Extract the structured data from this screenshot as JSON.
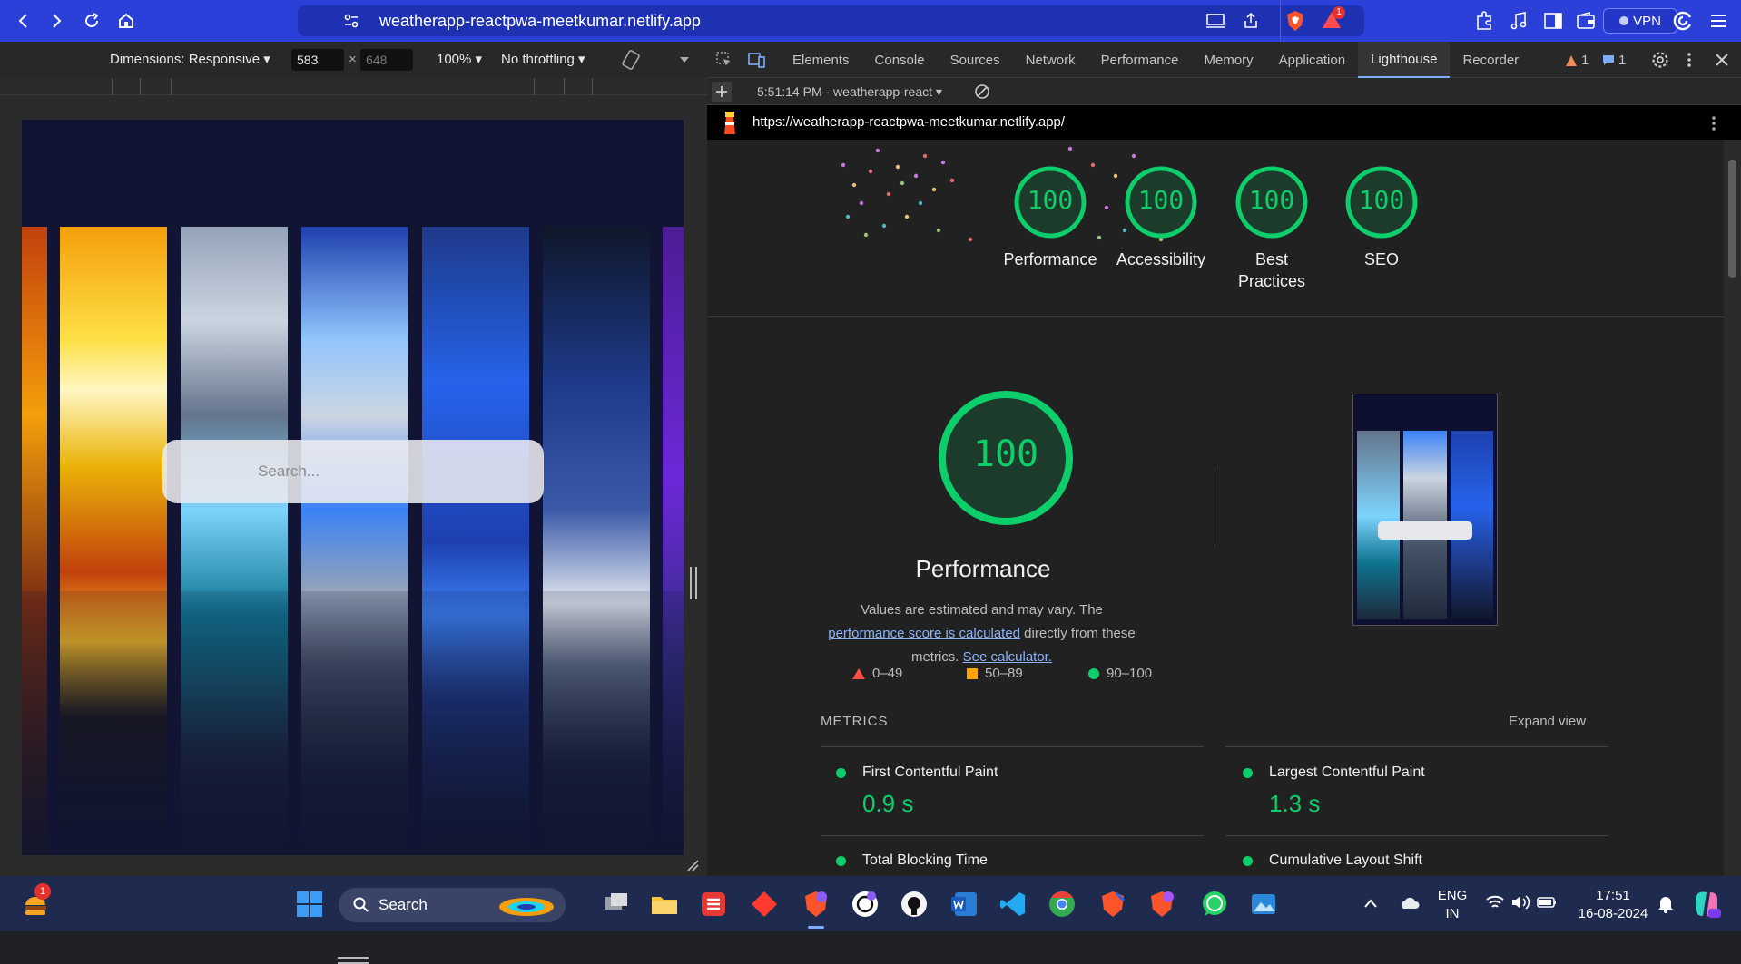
{
  "browser": {
    "url": "weatherapp-reactpwa-meetkumar.netlify.app",
    "vpn_label": "VPN",
    "alert_badge": "1"
  },
  "device_toolbar": {
    "dimensions_label": "Dimensions: Responsive ▾",
    "width": "583",
    "times": "×",
    "height": "648",
    "zoom": "100% ▾",
    "throttling": "No throttling ▾"
  },
  "viewport": {
    "search_placeholder": "Search..."
  },
  "devtools": {
    "tabs": [
      "Elements",
      "Console",
      "Sources",
      "Network",
      "Performance",
      "Memory",
      "Application",
      "Lighthouse",
      "Recorder"
    ],
    "active_tab": "Lighthouse",
    "warnings_count": "1",
    "messages_count": "1",
    "report_selector": "5:51:14 PM - weatherapp-react ▾",
    "report_url": "https://weatherapp-reactpwa-meetkumar.netlify.app/"
  },
  "lighthouse": {
    "gauges": [
      {
        "score": "100",
        "label": "Performance"
      },
      {
        "score": "100",
        "label": "Accessibility"
      },
      {
        "score": "100",
        "label": "Best Practices"
      },
      {
        "score": "100",
        "label": "SEO"
      }
    ],
    "main_score": "100",
    "main_title": "Performance",
    "desc_pre": "Values are estimated and may vary. The ",
    "desc_link1": "performance score is calculated",
    "desc_mid": " directly from these metrics. ",
    "desc_link2": "See calculator.",
    "legend": [
      "0–49",
      "50–89",
      "90–100"
    ],
    "metrics_heading": "METRICS",
    "expand_view": "Expand view",
    "metrics": [
      {
        "name": "First Contentful Paint",
        "value": "0.9 s"
      },
      {
        "name": "Largest Contentful Paint",
        "value": "1.3 s"
      },
      {
        "name": "Total Blocking Time",
        "value": ""
      },
      {
        "name": "Cumulative Layout Shift",
        "value": ""
      }
    ],
    "colors": {
      "pass": "#0cce6b",
      "average": "#ffa400",
      "fail": "#ff4e42"
    }
  },
  "taskbar": {
    "search_label": "Search",
    "notification_badge": "1",
    "lang_line1": "ENG",
    "lang_line2": "IN",
    "time": "17:51",
    "date": "16-08-2024"
  }
}
